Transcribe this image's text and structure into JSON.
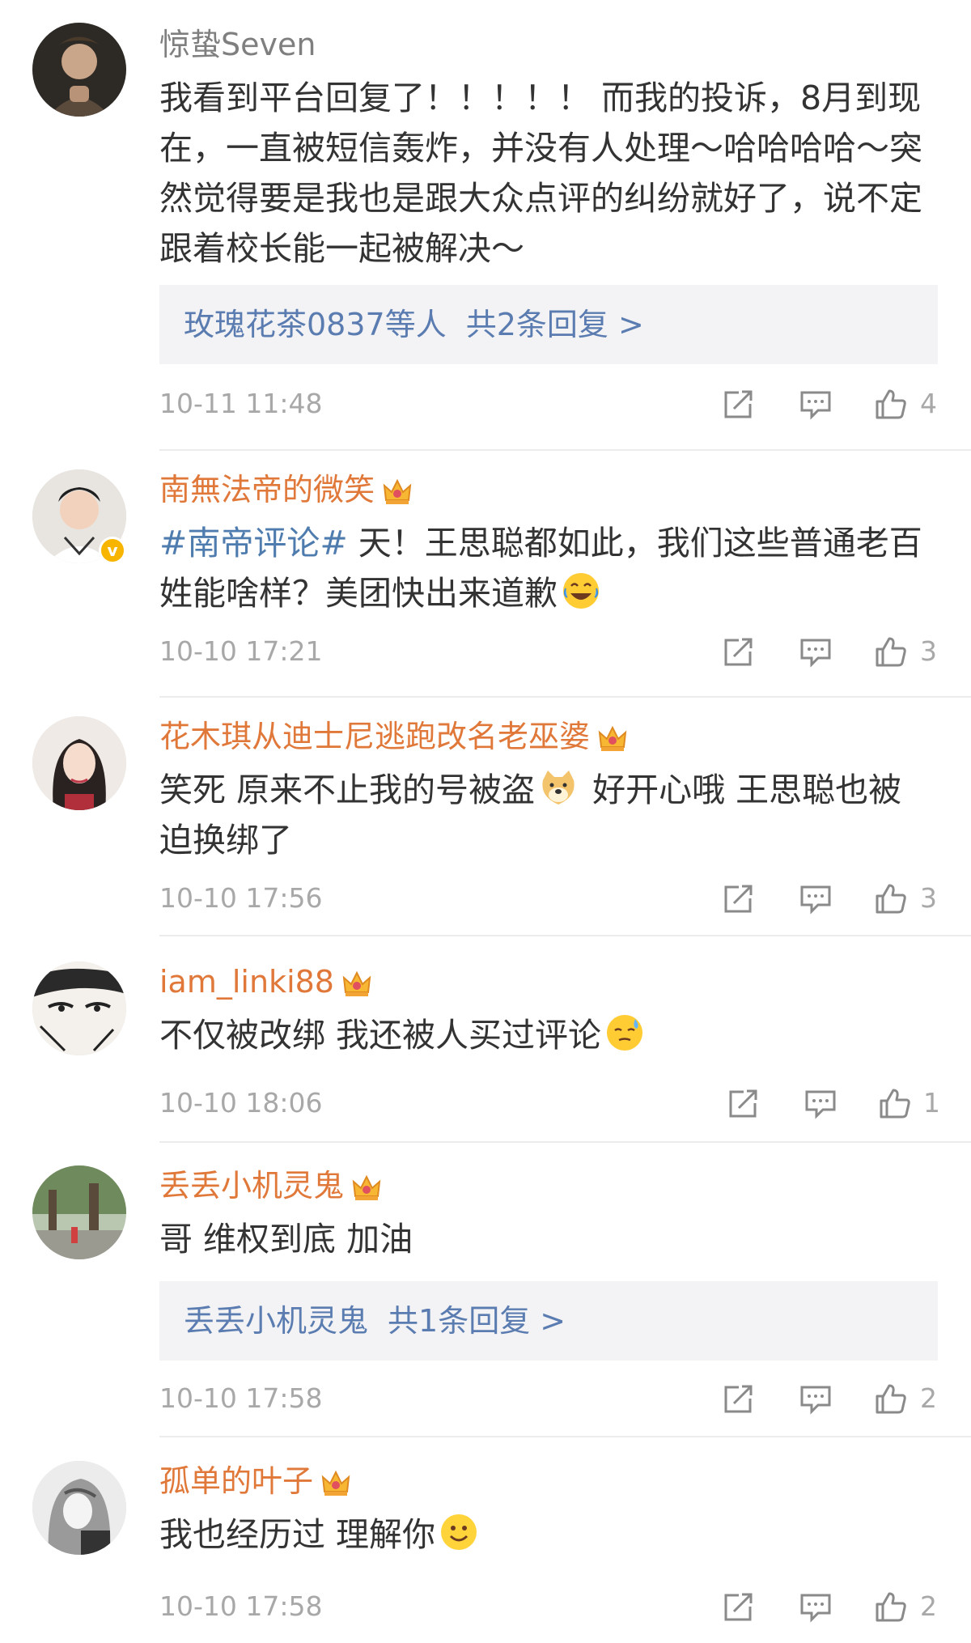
{
  "comments": [
    {
      "username": "惊蛰Seven",
      "text": "我看到平台回复了！！！！！ 而我的投诉，8月到现在，一直被短信轰炸，并没有人处理～哈哈哈哈～突然觉得要是我也是跟大众点评的纠纷就好了，说不定跟着校长能一起被解决～",
      "reply": {
        "users": "玫瑰花茶0837等人",
        "count_text": "共2条回复 >"
      },
      "time": "10-11 11:48",
      "likes": "4"
    },
    {
      "username": "南無法帝的微笑",
      "hashtag": "#南帝评论#",
      "text": " 天！王思聪都如此，我们这些普通老百姓能啥样？美团快出来道歉",
      "emoji": "laugh-cry-emoji",
      "verified": "v",
      "time": "10-10 17:21",
      "likes": "3"
    },
    {
      "username": "花木琪从迪士尼逃跑改名老巫婆",
      "text_before": "笑死 原来不止我的号被盗",
      "emoji": "doge-emoji",
      "text_after": " 好开心哦 王思聪也被迫换绑了",
      "time": "10-10 17:56",
      "likes": "3"
    },
    {
      "username": "iam_linki88",
      "text": "不仅被改绑 我还被人买过评论",
      "emoji": "sweat-emoji",
      "time": "10-10 18:06",
      "likes": "1"
    },
    {
      "username": "丢丢小机灵鬼",
      "text": "哥 维权到底 加油",
      "reply": {
        "users": "丢丢小机灵鬼",
        "count_text": "共1条回复 >"
      },
      "time": "10-10 17:58",
      "likes": "2"
    },
    {
      "username": "孤单的叶子",
      "text": "我也经历过 理解你",
      "emoji": "smile-emoji",
      "time": "10-10 17:58",
      "likes": "2"
    }
  ],
  "colors": {
    "username_plain": "#7f7f7f",
    "username_vip": "#e0783a",
    "link_blue": "#5a7cb0",
    "meta_gray": "#a8a8a8",
    "reply_bg": "#f3f3f5"
  }
}
